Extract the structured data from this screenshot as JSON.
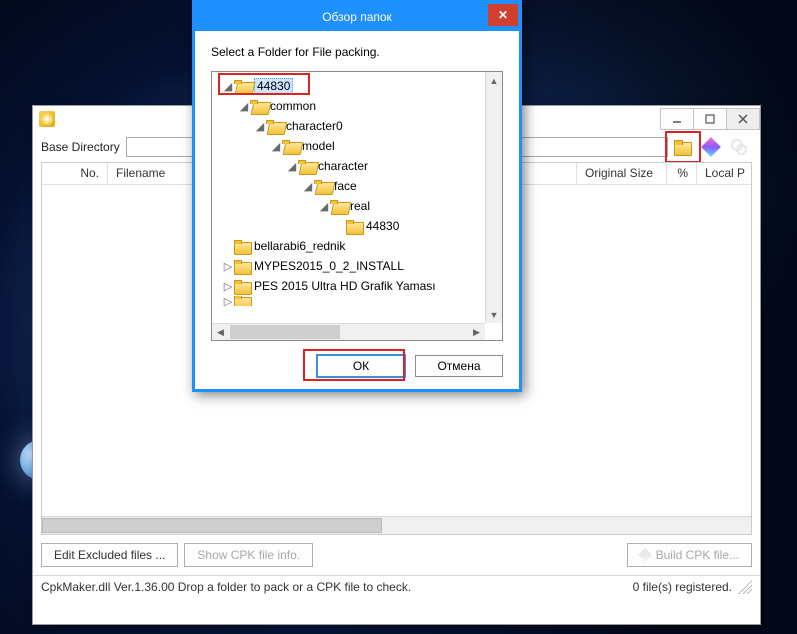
{
  "dialog": {
    "title": "Обзор папок",
    "message": "Select a Folder for File packing.",
    "ok": "ОК",
    "cancel": "Отмена",
    "tree": [
      {
        "indent": 0,
        "expander": "◢",
        "open": true,
        "label": "44830",
        "selected": true
      },
      {
        "indent": 1,
        "expander": "◢",
        "open": true,
        "label": "common"
      },
      {
        "indent": 2,
        "expander": "◢",
        "open": true,
        "label": "character0"
      },
      {
        "indent": 3,
        "expander": "◢",
        "open": true,
        "label": "model"
      },
      {
        "indent": 4,
        "expander": "◢",
        "open": true,
        "label": "character"
      },
      {
        "indent": 5,
        "expander": "◢",
        "open": true,
        "label": "face"
      },
      {
        "indent": 6,
        "expander": "◢",
        "open": true,
        "label": "real"
      },
      {
        "indent": 7,
        "expander": "",
        "open": false,
        "label": "44830"
      },
      {
        "indent": 0,
        "expander": "",
        "open": false,
        "label": "bellarabi6_rednik"
      },
      {
        "indent": 0,
        "expander": "▷",
        "open": false,
        "label": "MYPES2015_0_2_INSTALL"
      },
      {
        "indent": 0,
        "expander": "▷",
        "open": false,
        "label": "PES 2015 Ultra HD Grafik Yaması"
      }
    ]
  },
  "parent": {
    "baseDirLabel": "Base Directory",
    "baseDirValue": "",
    "columns": {
      "no": "No.",
      "filename": "Filename",
      "osize": "Original Size",
      "pct": "%",
      "local": "Local P"
    },
    "buttons": {
      "edit": "Edit Excluded files ...",
      "show": "Show CPK file info.",
      "build": "Build CPK file..."
    },
    "status": {
      "left": "CpkMaker.dll Ver.1.36.00  Drop a folder to pack or a CPK file to check.",
      "right": "0 file(s) registered."
    }
  }
}
